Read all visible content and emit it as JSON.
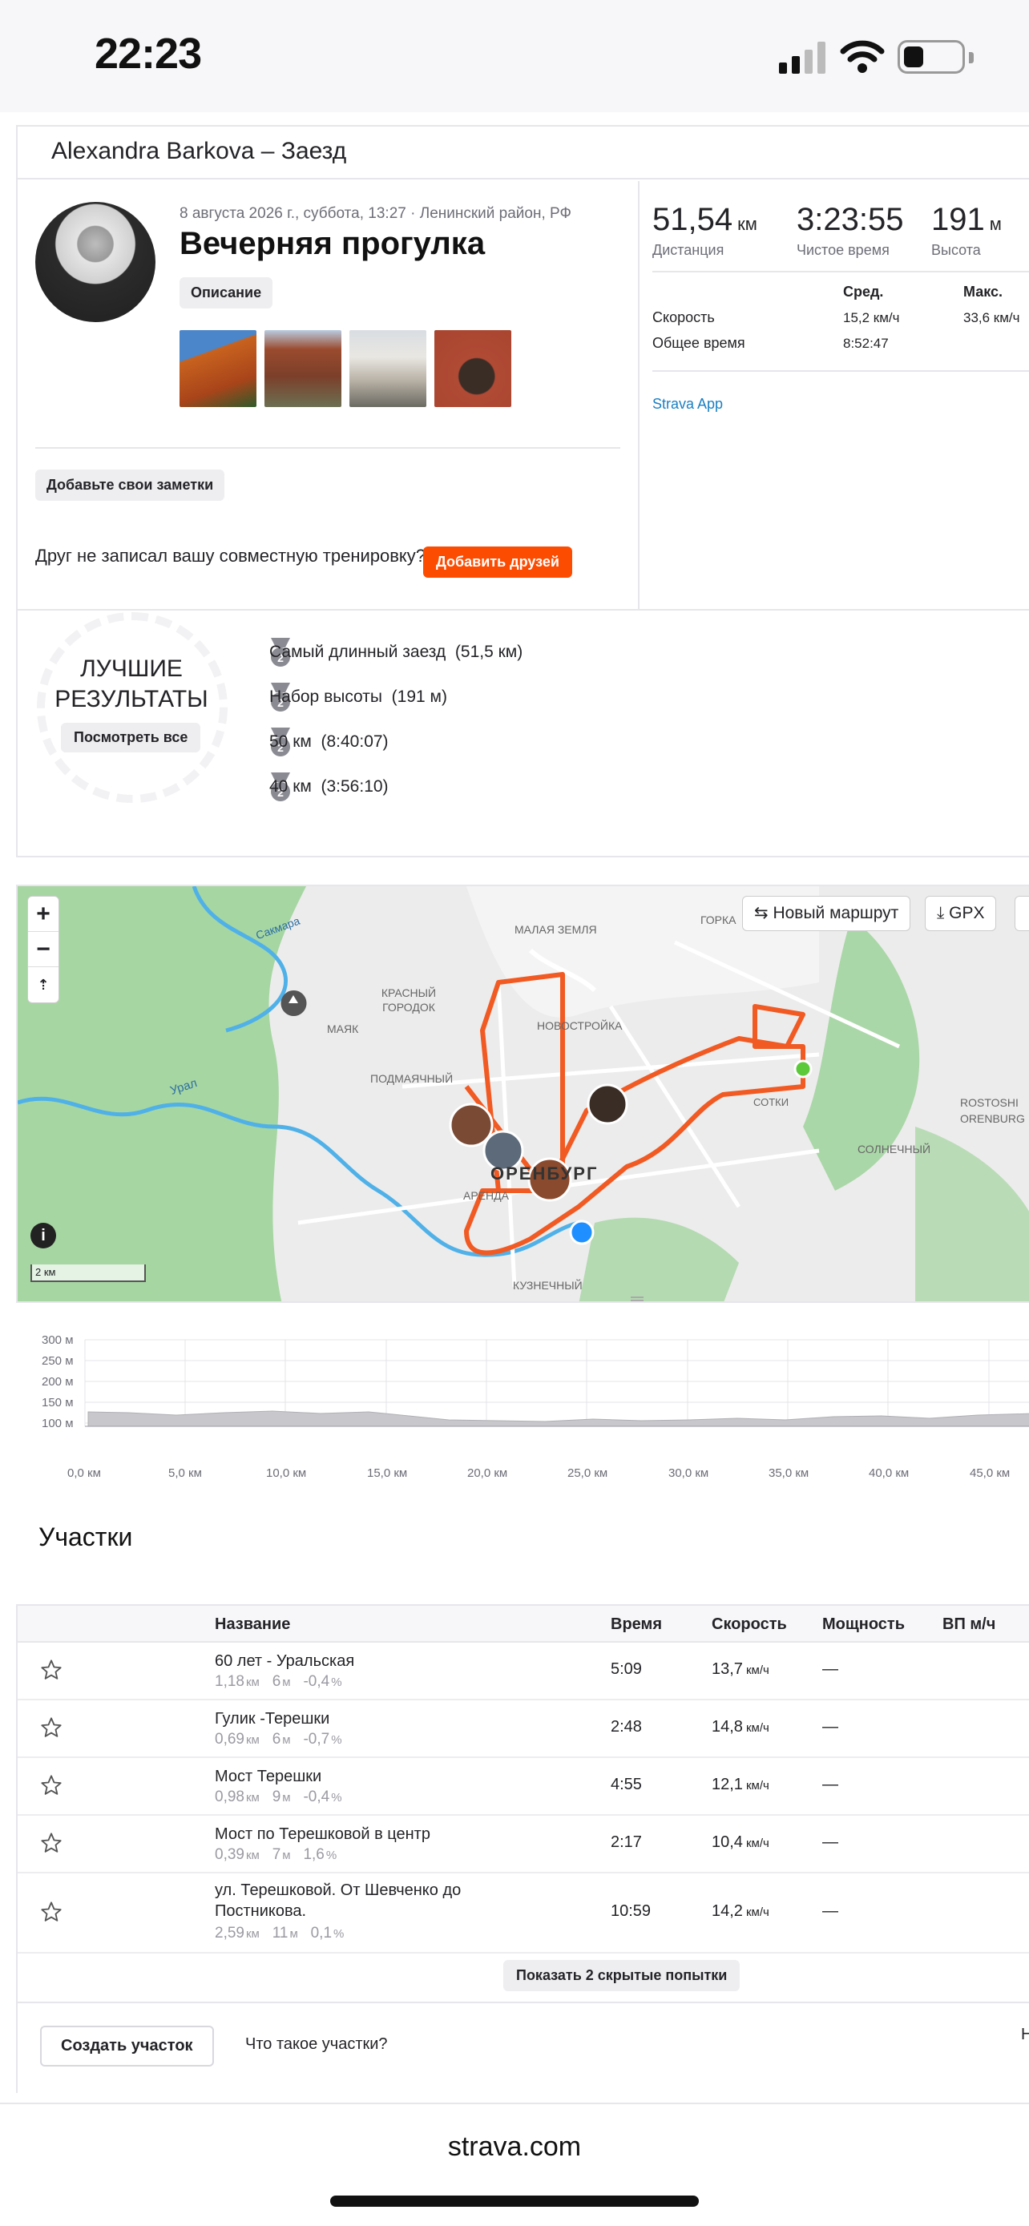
{
  "status_bar": {
    "time": "22:23"
  },
  "header": {
    "title": "Alexandra Barkova – Заезд"
  },
  "activity": {
    "meta": "8 августа 2026 г., суббота, 13:27 · Ленинский район, РФ",
    "name": "Вечерняя прогулка",
    "description_label": "Описание",
    "notes_button": "Добавьте свои заметки",
    "friend_prompt": "Друг не записал вашу совместную тренировку?",
    "add_friends_button": "Добавить друзей"
  },
  "stats": {
    "distance": {
      "value": "51,54",
      "unit": "км",
      "label": "Дистанция"
    },
    "moving_time": {
      "value": "3:23:55",
      "label": "Чистое время"
    },
    "elevation": {
      "value": "191",
      "unit": "м",
      "label": "Высота"
    },
    "col_avg": "Сред.",
    "col_max": "Макс.",
    "speed_label": "Скорость",
    "speed_avg": "15,2 км/ч",
    "speed_max": "33,6 км/ч",
    "elapsed_label": "Общее время",
    "elapsed_value": "8:52:47",
    "device": "Strava App"
  },
  "best": {
    "title_line1": "ЛУЧШИЕ",
    "title_line2": "РЕЗУЛЬТАТЫ",
    "see_all": "Посмотреть все",
    "items": [
      {
        "label": "Самый длинный заезд",
        "value": "(51,5 км)"
      },
      {
        "label": "Набор высоты",
        "value": "(191 м)"
      },
      {
        "label": "50 км",
        "value": "(8:40:07)"
      },
      {
        "label": "40 км",
        "value": "(3:56:10)"
      }
    ],
    "medal_rank": "2"
  },
  "map": {
    "zoom_in": "+",
    "zoom_out": "−",
    "new_route": "Новый маршрут",
    "gpx": "GPX",
    "scale": "2 км",
    "labels": [
      "Сакмара",
      "МАЛАЯ ЗЕМЛЯ",
      "ГОРКА",
      "КРАСНЫЙ ГОРОДОК",
      "МАЯК",
      "НОВОСТРОЙКА",
      "ПОДМАЯЧНЫЙ",
      "Урал",
      "СОТКИ",
      "ROSTOSHI",
      "ORENBURG",
      "СОЛНЕЧНЫЙ",
      "ОРЕНБУРГ",
      "АРЕНДА",
      "КУЗНЕЧНЫЙ"
    ]
  },
  "elevation_chart": {
    "y_ticks": [
      "300 м",
      "250 м",
      "200 м",
      "150 м",
      "100 м"
    ],
    "x_ticks": [
      "0,0 км",
      "5,0 км",
      "10,0 км",
      "15,0 км",
      "20,0 км",
      "25,0 км",
      "30,0 км",
      "35,0 км",
      "40,0 км",
      "45,0 км"
    ]
  },
  "segments": {
    "title": "Участки",
    "headers": {
      "name": "Название",
      "time": "Время",
      "speed": "Скорость",
      "power": "Мощность",
      "vam": "ВП м/ч"
    },
    "rows": [
      {
        "name": "60 лет - Уральская",
        "dist": "1,18",
        "dist_u": "км",
        "elev": "6",
        "elev_u": "м",
        "grade": "-0,4",
        "grade_u": "%",
        "time": "5:09",
        "speed": "13,7",
        "speed_u": "км/ч",
        "power": "—"
      },
      {
        "name": "Гулик -Терешки",
        "dist": "0,69",
        "dist_u": "км",
        "elev": "6",
        "elev_u": "м",
        "grade": "-0,7",
        "grade_u": "%",
        "time": "2:48",
        "speed": "14,8",
        "speed_u": "км/ч",
        "power": "—"
      },
      {
        "name": "Мост Терешки",
        "dist": "0,98",
        "dist_u": "км",
        "elev": "9",
        "elev_u": "м",
        "grade": "-0,4",
        "grade_u": "%",
        "time": "4:55",
        "speed": "12,1",
        "speed_u": "км/ч",
        "power": "—"
      },
      {
        "name": "Мост по Терешковой в центр",
        "dist": "0,39",
        "dist_u": "км",
        "elev": "7",
        "elev_u": "м",
        "grade": "1,6",
        "grade_u": "%",
        "time": "2:17",
        "speed": "10,4",
        "speed_u": "км/ч",
        "power": "—"
      },
      {
        "name": "ул. Терешковой. От Шевченко до",
        "name2": "Постникова.",
        "dist": "2,59",
        "dist_u": "км",
        "elev": "11",
        "elev_u": "м",
        "grade": "0,1",
        "grade_u": "%",
        "time": "10:59",
        "speed": "14,2",
        "speed_u": "км/ч",
        "power": "—"
      }
    ],
    "show_hidden": "Показать 2 скрытые попытки",
    "create": "Создать участок",
    "what": "Что такое участки?",
    "cut_text": "Н"
  },
  "browser": {
    "url": "strava.com"
  },
  "colors": {
    "accent": "#fc4c02",
    "link": "#1a7fc2",
    "route": "#f15a22",
    "water": "#4fb1e8",
    "park": "#8fcf8a"
  }
}
